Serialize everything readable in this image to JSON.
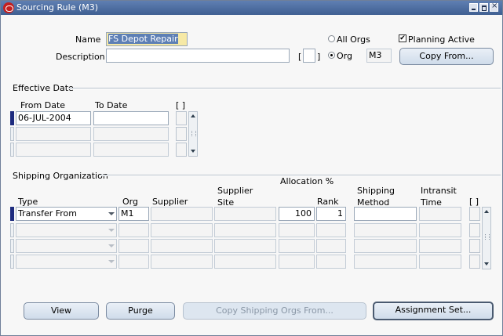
{
  "window": {
    "title": "Sourcing Rule (M3)"
  },
  "header": {
    "name_label": "Name",
    "name_value": "FS Depot Repair",
    "description_label": "Description",
    "description_value": "",
    "bracket_open": "[",
    "bracket_close": "]",
    "all_orgs_label": "All Orgs",
    "org_label": "Org",
    "org_value": "M3",
    "planning_active_label": "Planning Active",
    "planning_active_check": "✔",
    "copy_from_button": "Copy From..."
  },
  "effective_date": {
    "section_title": "Effective Date",
    "col_from": "From Date",
    "col_to": "To Date",
    "col_flex": "[ ]",
    "rows": [
      {
        "from": "06-JUL-2004",
        "to": ""
      },
      {
        "from": "",
        "to": ""
      },
      {
        "from": "",
        "to": ""
      }
    ]
  },
  "shipping": {
    "section_title": "Shipping Organization",
    "allocation_header": "Allocation %",
    "col_type": "Type",
    "col_org": "Org",
    "col_supplier": "Supplier",
    "col_supplier_site": "Supplier Site",
    "col_rank": "Rank",
    "col_shipping_method": "Shipping Method",
    "col_intransit_time": "Intransit Time",
    "col_flex": "[ ]",
    "rows": [
      {
        "type": "Transfer From",
        "org": "M1",
        "supplier": "",
        "supplier_site": "",
        "allocation": "100",
        "rank": "1",
        "shipping_method": "",
        "intransit_time": ""
      },
      {
        "type": "",
        "org": "",
        "supplier": "",
        "supplier_site": "",
        "allocation": "",
        "rank": "",
        "shipping_method": "",
        "intransit_time": ""
      },
      {
        "type": "",
        "org": "",
        "supplier": "",
        "supplier_site": "",
        "allocation": "",
        "rank": "",
        "shipping_method": "",
        "intransit_time": ""
      },
      {
        "type": "",
        "org": "",
        "supplier": "",
        "supplier_site": "",
        "allocation": "",
        "rank": "",
        "shipping_method": "",
        "intransit_time": ""
      }
    ]
  },
  "buttons": {
    "view": "View",
    "purge": "Purge",
    "copy_shipping": "Copy Shipping Orgs From...",
    "assignment_set": "Assignment Set..."
  }
}
